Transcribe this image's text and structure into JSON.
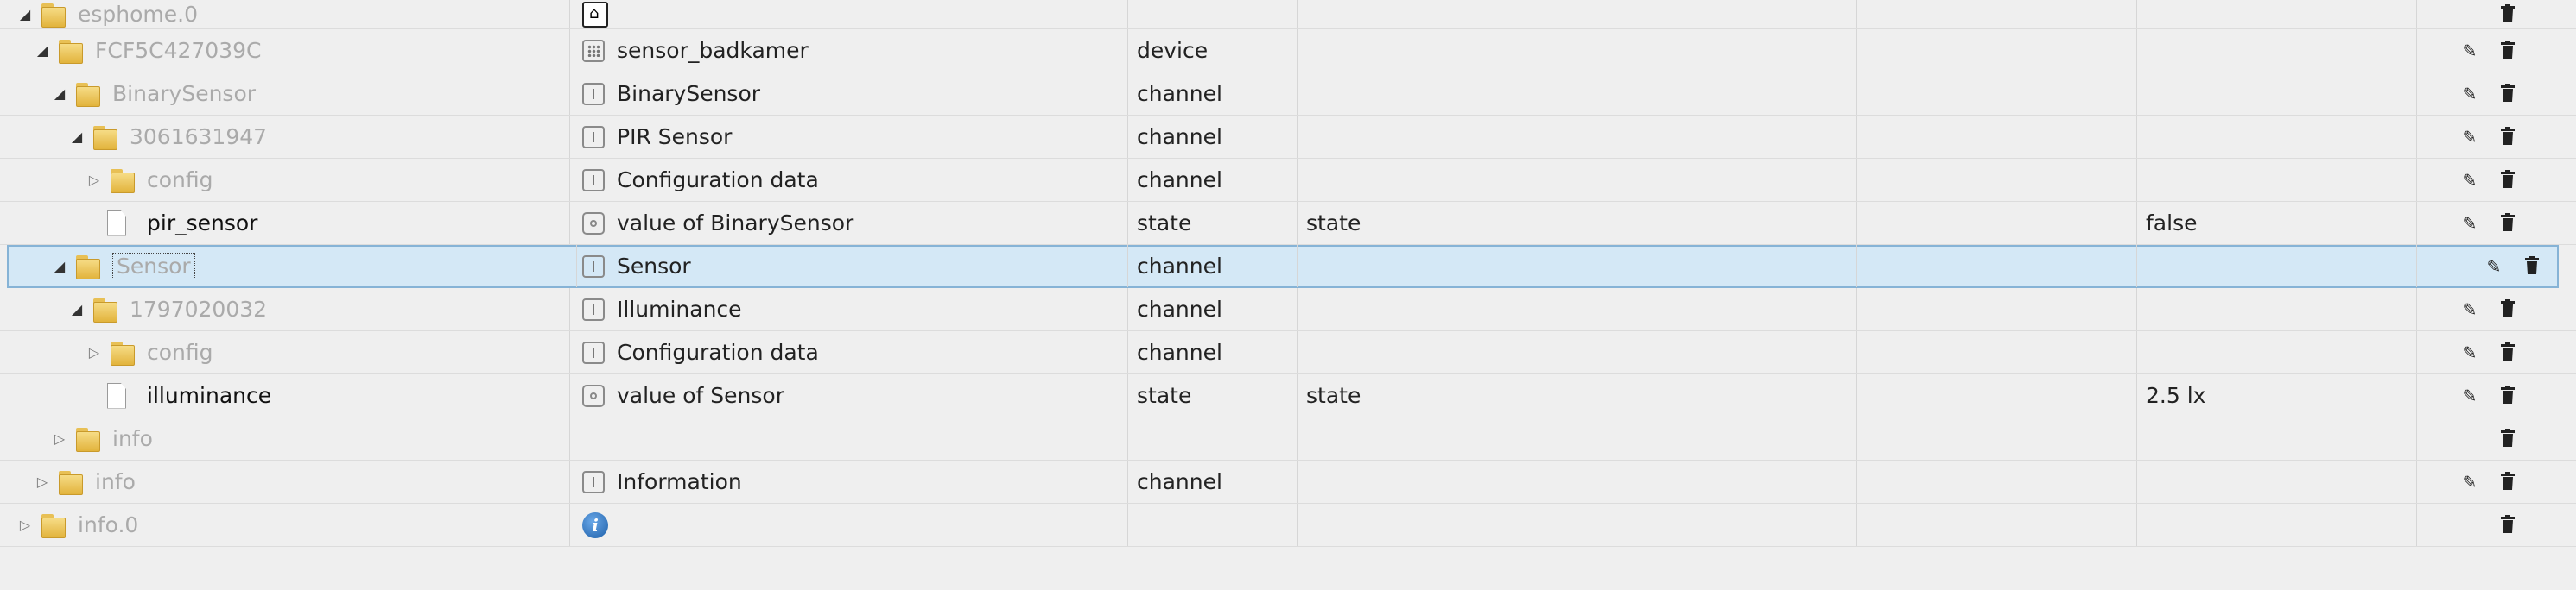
{
  "rows": [
    {
      "id": "esphome.0",
      "indent": 0,
      "kind": "folder",
      "toggle": "open",
      "icon": "chip-icon",
      "name": "",
      "type": "",
      "role": "",
      "value": "",
      "edit": false
    },
    {
      "id": "FCF5C427039C",
      "indent": 1,
      "kind": "folder",
      "toggle": "open",
      "icon": "device-icon",
      "name": "sensor_badkamer",
      "type": "device",
      "role": "",
      "value": "",
      "edit": true
    },
    {
      "id": "BinarySensor",
      "indent": 2,
      "kind": "folder",
      "toggle": "open",
      "icon": "channel-icon",
      "name": "BinarySensor",
      "type": "channel",
      "role": "",
      "value": "",
      "edit": true
    },
    {
      "id": "3061631947",
      "indent": 3,
      "kind": "folder",
      "toggle": "open",
      "icon": "channel-icon",
      "name": "PIR Sensor",
      "type": "channel",
      "role": "",
      "value": "",
      "edit": true
    },
    {
      "id": "config",
      "indent": 4,
      "kind": "folder",
      "toggle": "closed",
      "icon": "channel-icon",
      "name": "Configuration data",
      "type": "channel",
      "role": "",
      "value": "",
      "edit": true
    },
    {
      "id": "pir_sensor",
      "indent": 4,
      "kind": "file",
      "toggle": "",
      "icon": "state-icon",
      "name": "value of BinarySensor",
      "type": "state",
      "role": "state",
      "value": "false",
      "edit": true
    },
    {
      "id": "Sensor",
      "indent": 2,
      "kind": "folder",
      "toggle": "open",
      "icon": "channel-icon",
      "name": "Sensor",
      "type": "channel",
      "role": "",
      "value": "",
      "edit": true,
      "selected": true
    },
    {
      "id": "1797020032",
      "indent": 3,
      "kind": "folder",
      "toggle": "open",
      "icon": "channel-icon",
      "name": "Illuminance",
      "type": "channel",
      "role": "",
      "value": "",
      "edit": true
    },
    {
      "id": "config",
      "indent": 4,
      "kind": "folder",
      "toggle": "closed",
      "icon": "channel-icon",
      "name": "Configuration data",
      "type": "channel",
      "role": "",
      "value": "",
      "edit": true
    },
    {
      "id": "illuminance",
      "indent": 4,
      "kind": "file",
      "toggle": "",
      "icon": "state-icon",
      "name": "value of Sensor",
      "type": "state",
      "role": "state",
      "value": "2.5 lx",
      "edit": true
    },
    {
      "id": "info",
      "indent": 2,
      "kind": "folder",
      "toggle": "closed",
      "icon": "",
      "name": "",
      "type": "",
      "role": "",
      "value": "",
      "edit": false
    },
    {
      "id": "info",
      "indent": 1,
      "kind": "folder",
      "toggle": "closed",
      "icon": "channel-icon",
      "name": "Information",
      "type": "channel",
      "role": "",
      "value": "",
      "edit": true
    },
    {
      "id": "info.0",
      "indent": 0,
      "kind": "folder",
      "toggle": "closed",
      "icon": "info-icon",
      "name": "",
      "type": "",
      "role": "",
      "value": "",
      "edit": false
    }
  ],
  "icons": {
    "edit": "pencil-icon",
    "delete": "trash-icon"
  }
}
